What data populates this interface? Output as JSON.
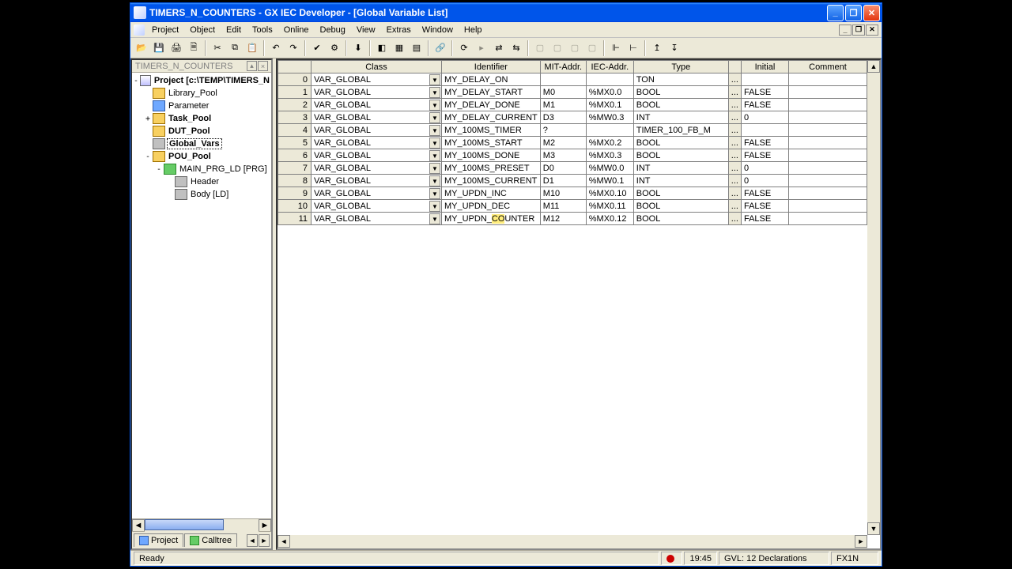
{
  "colors": {
    "titlebar": "#0055ea",
    "chrome": "#ece9d8",
    "highlight": "#ffe646"
  },
  "title": "TIMERS_N_COUNTERS - GX IEC Developer - [Global Variable List]",
  "menu": [
    "Project",
    "Object",
    "Edit",
    "Tools",
    "Online",
    "Debug",
    "View",
    "Extras",
    "Window",
    "Help"
  ],
  "tree": {
    "header": "TIMERS_N_COUNTERS",
    "root": "Project [c:\\TEMP\\TIMERS_N",
    "nodes": [
      {
        "label": "Library_Pool",
        "indent": 1,
        "icon": "ico-folder",
        "toggle": ""
      },
      {
        "label": "Parameter",
        "indent": 1,
        "icon": "ico-blue",
        "toggle": ""
      },
      {
        "label": "Task_Pool",
        "indent": 1,
        "icon": "ico-folder",
        "toggle": "+",
        "bold": true
      },
      {
        "label": "DUT_Pool",
        "indent": 1,
        "icon": "ico-folder",
        "toggle": "",
        "bold": true
      },
      {
        "label": "Global_Vars",
        "indent": 1,
        "icon": "ico-grey",
        "toggle": "",
        "selected": true,
        "bold": true
      },
      {
        "label": "POU_Pool",
        "indent": 1,
        "icon": "ico-folder",
        "toggle": "-",
        "bold": true
      },
      {
        "label": "MAIN_PRG_LD [PRG]",
        "indent": 2,
        "icon": "ico-green",
        "toggle": "-"
      },
      {
        "label": "Header",
        "indent": 3,
        "icon": "ico-grey",
        "toggle": ""
      },
      {
        "label": "Body [LD]",
        "indent": 3,
        "icon": "ico-grey",
        "toggle": ""
      }
    ],
    "tabs": [
      {
        "label": "Project",
        "icon": "ico-blue"
      },
      {
        "label": "Calltree",
        "icon": "ico-green"
      }
    ]
  },
  "grid": {
    "headers": [
      "",
      "Class",
      "Identifier",
      "MIT-Addr.",
      "IEC-Addr.",
      "Type",
      "",
      "Initial",
      "Comment"
    ],
    "rows": [
      {
        "n": 0,
        "class": "VAR_GLOBAL",
        "ident": "MY_DELAY_ON",
        "mit": "",
        "iec": "",
        "type": "TON",
        "init": "",
        "comment": ""
      },
      {
        "n": 1,
        "class": "VAR_GLOBAL",
        "ident": "MY_DELAY_START",
        "mit": "M0",
        "iec": "%MX0.0",
        "type": "BOOL",
        "init": "FALSE",
        "comment": ""
      },
      {
        "n": 2,
        "class": "VAR_GLOBAL",
        "ident": "MY_DELAY_DONE",
        "mit": "M1",
        "iec": "%MX0.1",
        "type": "BOOL",
        "init": "FALSE",
        "comment": ""
      },
      {
        "n": 3,
        "class": "VAR_GLOBAL",
        "ident": "MY_DELAY_CURRENT",
        "mit": "D3",
        "iec": "%MW0.3",
        "type": "INT",
        "init": "0",
        "comment": ""
      },
      {
        "n": 4,
        "class": "VAR_GLOBAL",
        "ident": "MY_100MS_TIMER",
        "mit": "?",
        "iec": "",
        "type": "TIMER_100_FB_M",
        "init": "",
        "comment": ""
      },
      {
        "n": 5,
        "class": "VAR_GLOBAL",
        "ident": "MY_100MS_START",
        "mit": "M2",
        "iec": "%MX0.2",
        "type": "BOOL",
        "init": "FALSE",
        "comment": ""
      },
      {
        "n": 6,
        "class": "VAR_GLOBAL",
        "ident": "MY_100MS_DONE",
        "mit": "M3",
        "iec": "%MX0.3",
        "type": "BOOL",
        "init": "FALSE",
        "comment": ""
      },
      {
        "n": 7,
        "class": "VAR_GLOBAL",
        "ident": "MY_100MS_PRESET",
        "mit": "D0",
        "iec": "%MW0.0",
        "type": "INT",
        "init": "0",
        "comment": ""
      },
      {
        "n": 8,
        "class": "VAR_GLOBAL",
        "ident": "MY_100MS_CURRENT",
        "mit": "D1",
        "iec": "%MW0.1",
        "type": "INT",
        "init": "0",
        "comment": ""
      },
      {
        "n": 9,
        "class": "VAR_GLOBAL",
        "ident": "MY_UPDN_INC",
        "mit": "M10",
        "iec": "%MX0.10",
        "type": "BOOL",
        "init": "FALSE",
        "comment": ""
      },
      {
        "n": 10,
        "class": "VAR_GLOBAL",
        "ident": "MY_UPDN_DEC",
        "mit": "M11",
        "iec": "%MX0.11",
        "type": "BOOL",
        "init": "FALSE",
        "comment": ""
      },
      {
        "n": 11,
        "class": "VAR_GLOBAL",
        "ident": "MY_UPDN_COUNTER",
        "mit": "M12",
        "iec": "%MX0.12",
        "type": "BOOL",
        "init": "FALSE",
        "comment": "",
        "highlight_ident": true
      }
    ]
  },
  "status": {
    "ready": "Ready",
    "time": "19:45",
    "decl": "GVL: 12 Declarations",
    "plc": "FX1N"
  },
  "icons": {
    "min": "_",
    "max": "❐",
    "close": "✕",
    "dd": "▼",
    "left": "◄",
    "right": "►",
    "up": "▲",
    "down": "▼",
    "dots": "..."
  }
}
